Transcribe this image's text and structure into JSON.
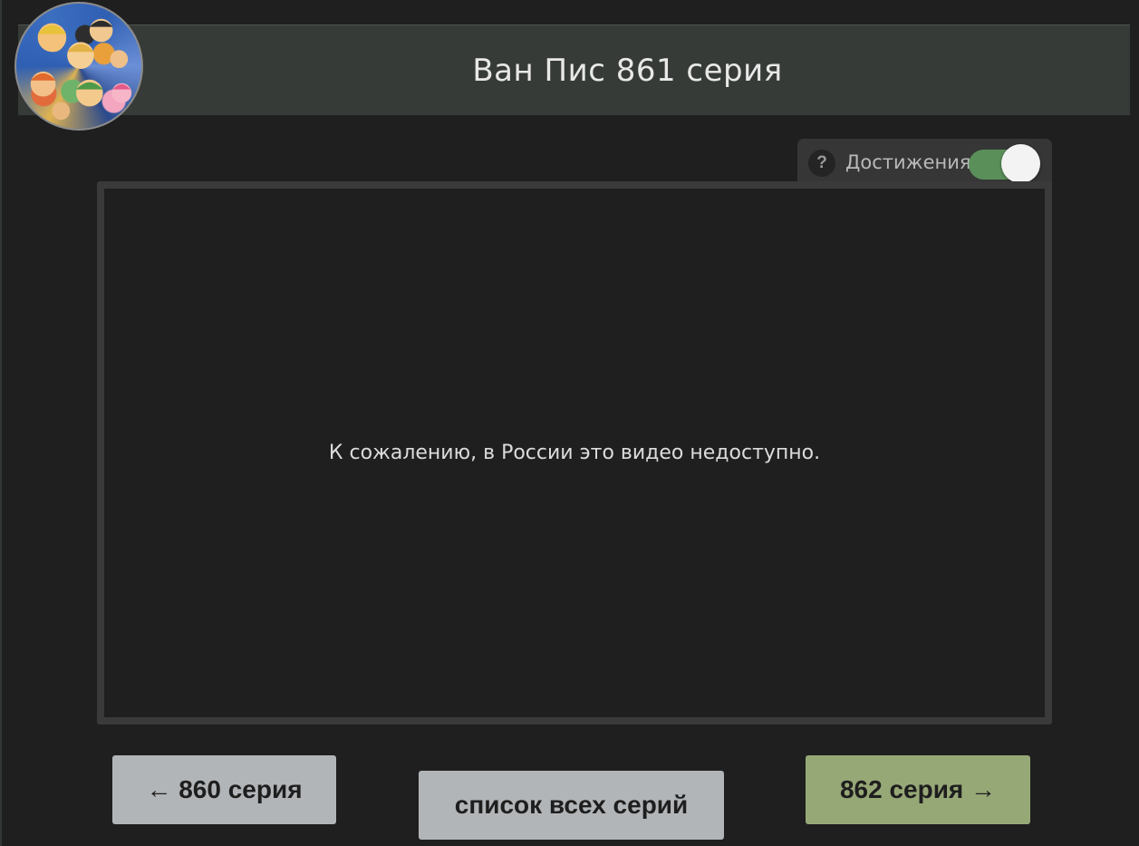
{
  "header": {
    "title": "Ван Пис 861 серия"
  },
  "achievements": {
    "help_symbol": "?",
    "label": "Достижения",
    "enabled": true
  },
  "player": {
    "message": "К сожалению, в России это видео недоступно."
  },
  "navigation": {
    "prev_label": "← 860 серия",
    "list_label": "список всех серий",
    "next_label": "862 серия →"
  },
  "colors": {
    "background": "#1f1f1f",
    "header_bg": "#363b37",
    "toggle_on": "#5b8f5a",
    "button_gray": "#b2b5b8",
    "button_green": "#97a877"
  }
}
